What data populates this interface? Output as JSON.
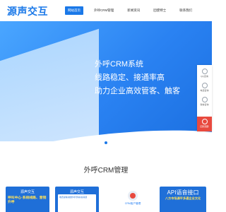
{
  "brand": {
    "name": "源声交互",
    "color": "#1a78e8"
  },
  "nav": {
    "items": [
      {
        "label": "网站首页",
        "active": true
      },
      {
        "label": "外呼CRM管理",
        "active": false
      },
      {
        "label": "新闻资讯",
        "active": false
      },
      {
        "label": "团使特士",
        "active": false
      },
      {
        "label": "联系我们",
        "active": false
      }
    ]
  },
  "hero": {
    "lines": [
      "外呼CRM系统",
      "线路稳定、接通率高",
      "助力企业高效管客、触客"
    ]
  },
  "sidebar": {
    "items": [
      {
        "label": "QQ咨询",
        "icon": "qq-icon"
      },
      {
        "label": "电话咨询",
        "icon": "phone-icon"
      },
      {
        "label": "微信咨询",
        "icon": "wechat-icon"
      },
      {
        "label": "回到顶部",
        "icon": "arrow-up-icon"
      }
    ]
  },
  "section": {
    "title": "外呼CRM管理"
  },
  "cards": [
    {
      "tag": "源声交互",
      "text": "呼叫中心·系统线路、营销外呼"
    },
    {
      "tag": "源声交互",
      "text": "电话营销系统外呼号码获客来源"
    },
    {
      "label": "CRM客户管理"
    },
    {
      "headline": "API语音接口",
      "sub": "八方市场源平多通企业文化"
    }
  ]
}
